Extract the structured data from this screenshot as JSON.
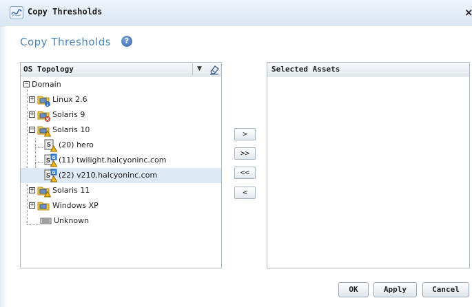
{
  "window": {
    "title": "Copy Thresholds",
    "close_label": "×"
  },
  "page": {
    "title": "Copy Thresholds",
    "help_label": "?"
  },
  "left_panel": {
    "header": "OS Topology",
    "dropdown_glyph": "▼"
  },
  "right_panel": {
    "header": "Selected Assets"
  },
  "tree": {
    "root": {
      "label": "Domain",
      "toggle": "−"
    },
    "items": [
      {
        "label": "Linux 2.6",
        "toggle": "+",
        "icon": "folder-info-icon"
      },
      {
        "label": "Solaris 9",
        "toggle": "+",
        "icon": "folder-error-icon"
      },
      {
        "label": "Solaris 10",
        "toggle": "−",
        "icon": "folder-warning-icon"
      },
      {
        "label": "(20) hero",
        "icon": "server-warning-icon"
      },
      {
        "label": "(11) twilight.halcyoninc.com",
        "icon": "server-global-warning-icon"
      },
      {
        "label": "(22) v210.halcyoninc.com",
        "icon": "server-global-warning-icon",
        "selected": true
      },
      {
        "label": "Solaris 11",
        "toggle": "+",
        "icon": "folder-warning-icon"
      },
      {
        "label": "Windows XP",
        "toggle": "+",
        "icon": "folder-icon"
      },
      {
        "label": "Unknown",
        "icon": "unknown-device-icon"
      }
    ]
  },
  "move_buttons": {
    "add": ">",
    "add_all": ">>",
    "remove_all": "<<",
    "remove": "<"
  },
  "footer": {
    "ok": "OK",
    "apply": "Apply",
    "cancel": "Cancel"
  },
  "colors": {
    "accent": "#4b86b7",
    "selection": "#dde9f5",
    "warning": "#f2b600",
    "error": "#d9301f",
    "info": "#2f6fc4"
  }
}
